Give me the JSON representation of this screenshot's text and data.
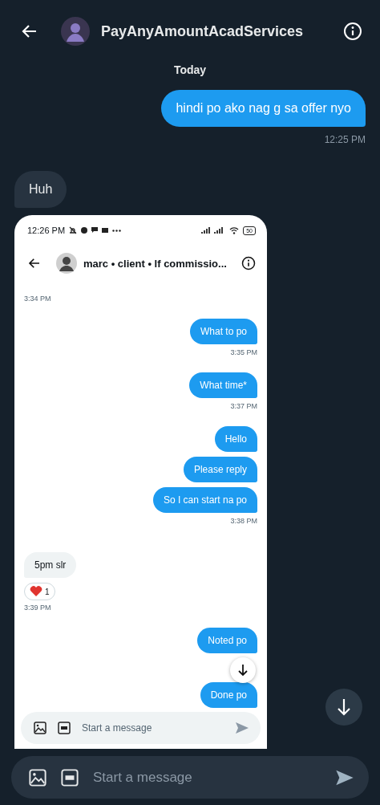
{
  "header": {
    "title": "PayAnyAmountAcadServices"
  },
  "day_label": "Today",
  "messages": [
    {
      "kind": "bubble",
      "outgoing": true,
      "text": "hindi po ako nag g sa offer nyo"
    },
    {
      "kind": "time",
      "outgoing": true,
      "text": "12:25 PM"
    },
    {
      "kind": "bubble",
      "outgoing": false,
      "text": "Huh"
    },
    {
      "kind": "screenshot"
    }
  ],
  "screenshot": {
    "status_bar": {
      "time": "12:26 PM",
      "battery": "50"
    },
    "header": {
      "title": "marc • client • lf commissio..."
    },
    "messages": [
      {
        "kind": "time",
        "outgoing": false,
        "text": "3:34 PM"
      },
      {
        "kind": "bubble",
        "outgoing": true,
        "text": "What to po"
      },
      {
        "kind": "time",
        "outgoing": true,
        "text": "3:35 PM"
      },
      {
        "kind": "bubble",
        "outgoing": true,
        "text": "What time*"
      },
      {
        "kind": "time",
        "outgoing": true,
        "text": "3:37 PM"
      },
      {
        "kind": "bubble",
        "outgoing": true,
        "text": "Hello"
      },
      {
        "kind": "bubble",
        "outgoing": true,
        "text": "Please reply"
      },
      {
        "kind": "bubble",
        "outgoing": true,
        "text": "So I can start na po"
      },
      {
        "kind": "time",
        "outgoing": true,
        "text": "3:38 PM"
      },
      {
        "kind": "bubble",
        "outgoing": false,
        "text": "5pm slr"
      },
      {
        "kind": "reaction",
        "text": "1"
      },
      {
        "kind": "time",
        "outgoing": false,
        "text": "3:39 PM"
      },
      {
        "kind": "bubble",
        "outgoing": true,
        "text": "Noted po"
      },
      {
        "kind": "gap"
      },
      {
        "kind": "bubble",
        "outgoing": true,
        "text": "Done po"
      }
    ],
    "composer": {
      "placeholder": "Start a message"
    }
  },
  "composer": {
    "placeholder": "Start a message"
  }
}
